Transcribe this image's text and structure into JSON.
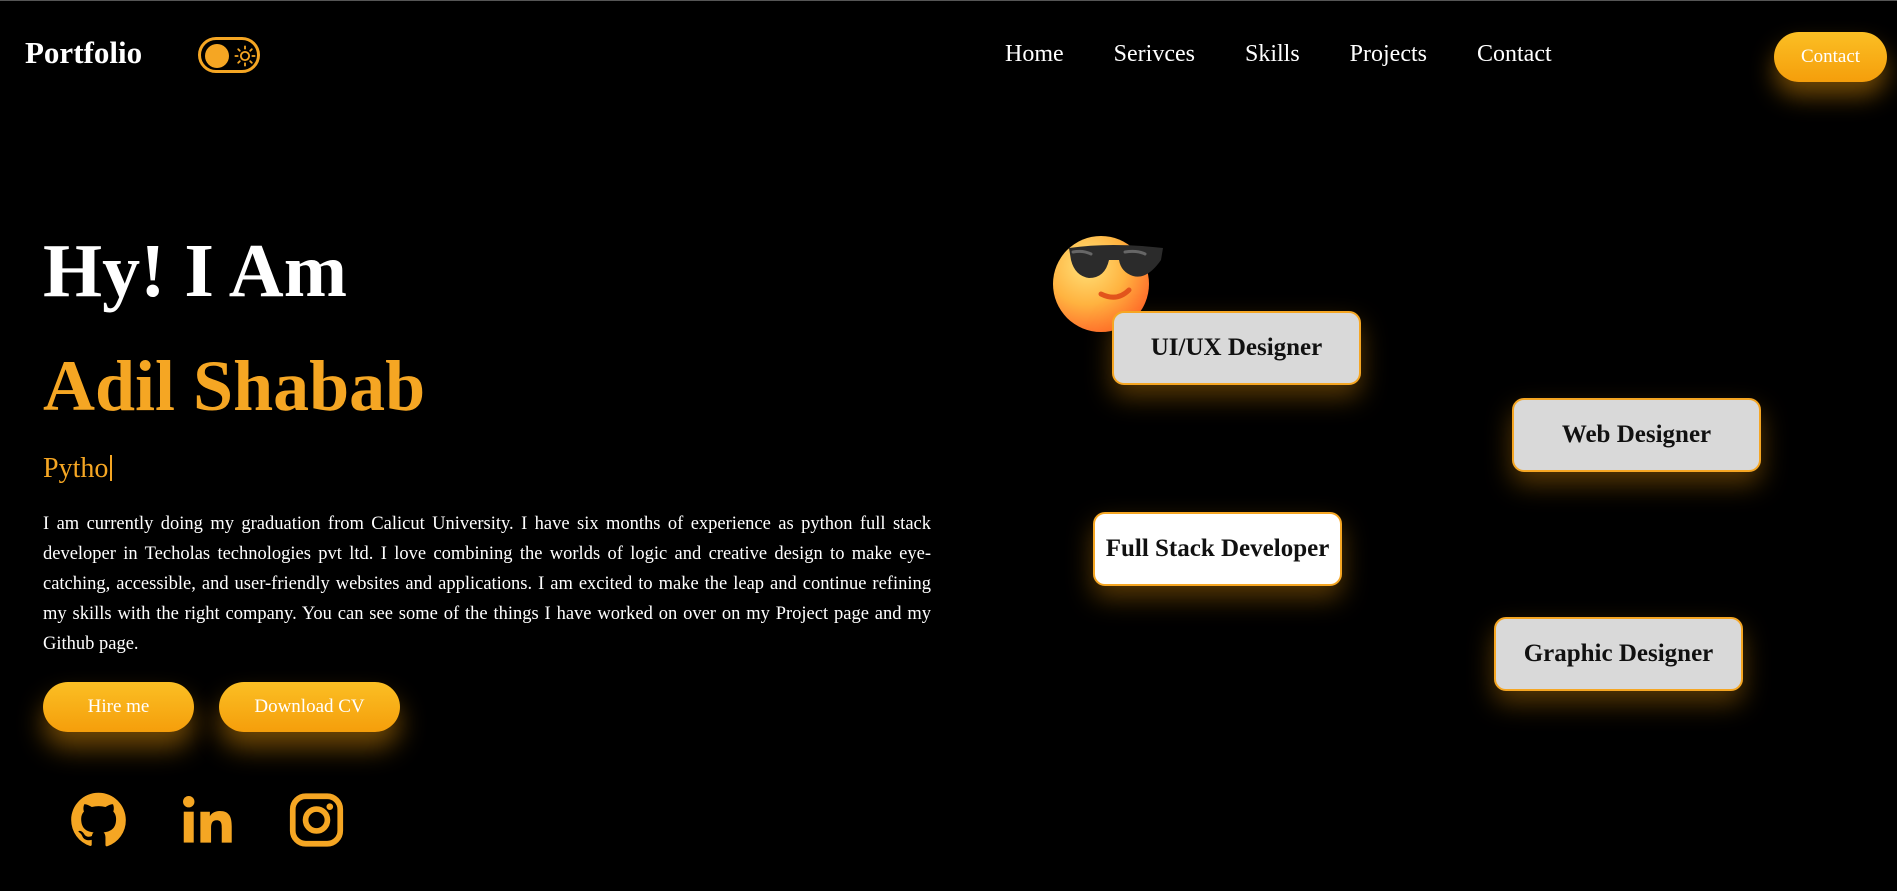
{
  "header": {
    "logo": "Portfolio",
    "nav": [
      "Home",
      "Serivces",
      "Skills",
      "Projects",
      "Contact"
    ],
    "contact_button": "Contact"
  },
  "hero": {
    "greeting": "Hy! I Am",
    "name": "Adil Shabab",
    "typed_text": "Pytho",
    "bio": "I am currently doing my graduation from Calicut University. I have six months of experience as python full stack developer in Techolas technologies pvt ltd. I love combining the worlds of logic and creative design to make eye-catching, accessible, and user-friendly websites and applications. I am excited to make the leap and continue refining my skills with the right company. You can see some of the things I have worked on over on my Project page and my Github page.",
    "buttons": {
      "hire": "Hire me",
      "cv": "Download CV"
    },
    "socials": [
      "github-icon",
      "linkedin-icon",
      "instagram-icon"
    ]
  },
  "roles": [
    "UI/UX Designer",
    "Web Designer",
    "Full Stack Developer",
    "Graphic Designer"
  ],
  "colors": {
    "accent": "#f5a623",
    "background": "#000000",
    "card": "#d9d9d9"
  }
}
